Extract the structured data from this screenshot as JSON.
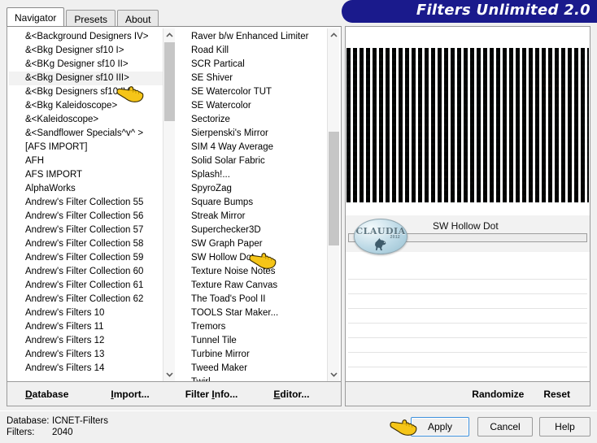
{
  "window": {
    "title": "Filters Unlimited 2.0"
  },
  "tabs": [
    {
      "label": "Navigator",
      "active": true
    },
    {
      "label": "Presets",
      "active": false
    },
    {
      "label": "About",
      "active": false
    }
  ],
  "categories": {
    "items": [
      "&<Background Designers IV>",
      "&<Bkg Designer sf10 I>",
      "&<BKg Designer sf10 II>",
      "&<Bkg Designer sf10 III>",
      "&<Bkg Designers sf10 IV>",
      "&<Bkg Kaleidoscope>",
      "&<Kaleidoscope>",
      "&<Sandflower Specials^v^ >",
      "[AFS IMPORT]",
      "AFH",
      "AFS IMPORT",
      "AlphaWorks",
      "Andrew's Filter Collection 55",
      "Andrew's Filter Collection 56",
      "Andrew's Filter Collection 57",
      "Andrew's Filter Collection 58",
      "Andrew's Filter Collection 59",
      "Andrew's Filter Collection 60",
      "Andrew's Filter Collection 61",
      "Andrew's Filter Collection 62",
      "Andrew's Filters 10",
      "Andrew's Filters 11",
      "Andrew's Filters 12",
      "Andrew's Filters 13",
      "Andrew's Filters 14"
    ],
    "hovered": "&<Bkg Designer sf10 III>"
  },
  "filters": {
    "items": [
      "Raver b/w Enhanced Limiter",
      "Road Kill",
      "SCR  Partical",
      "SE Shiver",
      "SE Watercolor TUT",
      "SE Watercolor",
      "Sectorize",
      "Sierpenski's Mirror",
      "SIM 4 Way Average",
      "Solid Solar Fabric",
      "Splash!...",
      "SpyroZag",
      "Square Bumps",
      "Streak Mirror",
      "Superchecker3D",
      "SW Graph Paper",
      "SW Hollow Dot",
      "Texture Noise Notes",
      "Texture Raw Canvas",
      "The Toad's Pool II",
      "TOOLS Star Maker...",
      "Tremors",
      "Tunnel Tile",
      "Turbine Mirror",
      "Tweed Maker",
      "Twirl"
    ],
    "selected": "SW Hollow Dot"
  },
  "params": {
    "filter_name": "SW Hollow Dot",
    "watermark_text": "CLAUDIA",
    "watermark_sub": "2012"
  },
  "menu": {
    "database": "Database",
    "database_accel": "D",
    "import": "Import...",
    "import_accel": "I",
    "filter_info": "Filter Info...",
    "filter_info_accel": "I",
    "editor": "Editor...",
    "editor_accel": "E"
  },
  "actions": {
    "randomize": "Randomize",
    "reset": "Reset",
    "apply": "Apply",
    "cancel": "Cancel",
    "help": "Help"
  },
  "status": {
    "database_label": "Database:",
    "database_value": "ICNET-Filters",
    "filters_label": "Filters:",
    "filters_value": "2040"
  },
  "colors": {
    "banner": "#1a1a8c",
    "selection": "#1569c7",
    "focus_border": "#3c8fdb",
    "panel": "#f0f0f0"
  },
  "icons": {
    "hand_left": "pointing-hand-icon",
    "hand_right": "pointing-hand-icon",
    "hand_apply": "pointing-hand-icon",
    "scroll_up": "chevron-up-icon",
    "scroll_down": "chevron-down-icon"
  }
}
